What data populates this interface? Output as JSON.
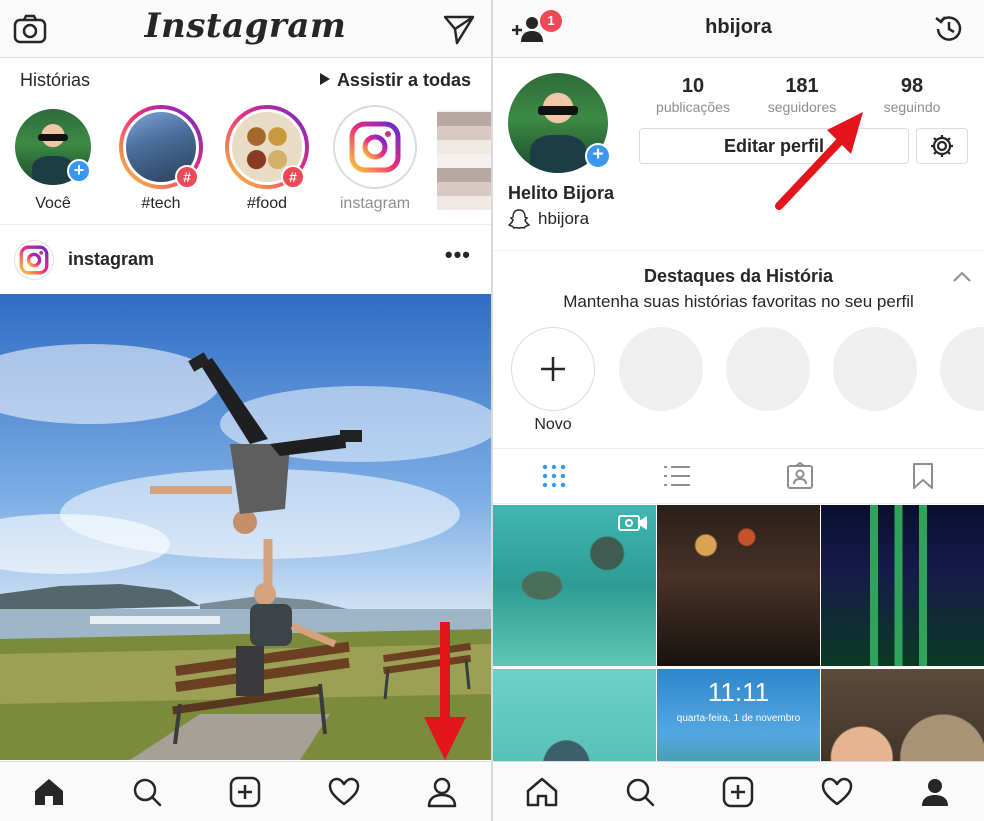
{
  "left": {
    "topbar": {
      "logo": "Instagram",
      "camera_icon": "camera-icon",
      "direct_icon": "paper-plane-icon"
    },
    "stories": {
      "heading": "Histórias",
      "watch_all": "Assistir a todas",
      "items": [
        {
          "label": "Você",
          "badge": "+"
        },
        {
          "label": "#tech",
          "badge": "#"
        },
        {
          "label": "#food",
          "badge": "#"
        },
        {
          "label": "instagram",
          "badge": ""
        }
      ]
    },
    "post": {
      "username": "instagram",
      "more": "•••"
    },
    "nav_icons": [
      "home-icon",
      "search-icon",
      "add-icon",
      "heart-icon",
      "profile-icon"
    ]
  },
  "right": {
    "topbar": {
      "username": "hbijora",
      "notification_count": "1",
      "add_person_icon": "add-person-icon",
      "history_icon": "history-icon"
    },
    "profile": {
      "full_name": "Helito Bijora",
      "snapchat": "hbijora",
      "stats": [
        {
          "num": "10",
          "label": "publicações"
        },
        {
          "num": "181",
          "label": "seguidores"
        },
        {
          "num": "98",
          "label": "seguindo"
        }
      ],
      "edit_button": "Editar perfil"
    },
    "highlights": {
      "title": "Destaques da História",
      "subtitle": "Mantenha suas histórias favoritas no seu perfil",
      "new_label": "Novo"
    },
    "grid": {
      "clock": "11:11",
      "date": "quarta-feira, 1 de novembro"
    },
    "nav_icons": [
      "home-icon",
      "search-icon",
      "add-icon",
      "heart-icon",
      "profile-icon"
    ]
  },
  "colors": {
    "accent_blue": "#3897f0",
    "badge_red": "#ed4956",
    "arrow_red": "#e3141b"
  }
}
